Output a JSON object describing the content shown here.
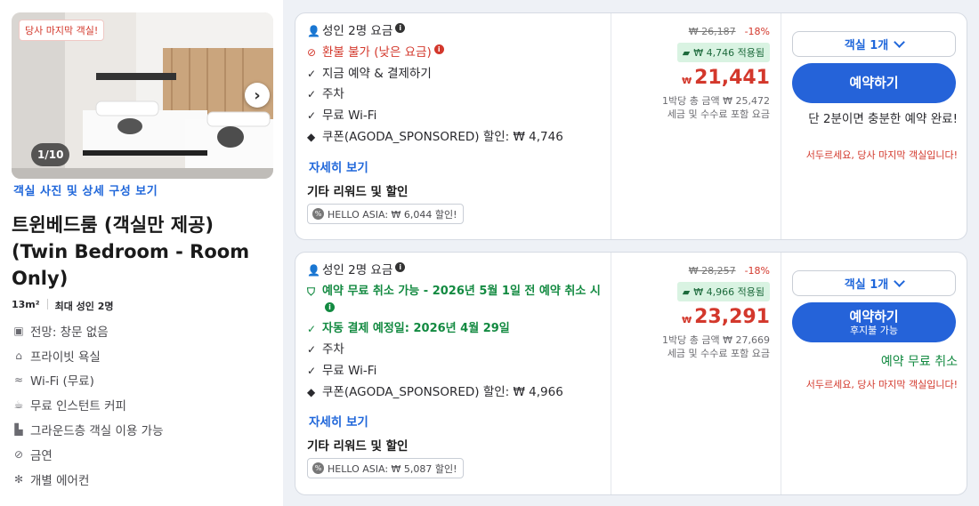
{
  "room": {
    "badge": "당사 마지막 객실!",
    "photo_counter": "1/10",
    "photo_link": "객실 사진 및 상세 구성 보기",
    "title": "트윈베드룸 (객실만 제공) (Twin Bedroom - Room Only)",
    "size": "13m²",
    "occupancy": "최대 성인 2명",
    "features": [
      {
        "icon": "window-icon",
        "label": "전망: 창문 없음"
      },
      {
        "icon": "bathtub-icon",
        "label": "프라이빗 욕실"
      },
      {
        "icon": "wifi-icon",
        "label": "Wi-Fi (무료)"
      },
      {
        "icon": "coffee-icon",
        "label": "무료 인스턴트 커피"
      },
      {
        "icon": "floor-icon",
        "label": "그라운드층 객실 이용 가능"
      },
      {
        "icon": "no-smoking-icon",
        "label": "금연"
      },
      {
        "icon": "aircon-icon",
        "label": "개별 에어컨"
      }
    ]
  },
  "offers": [
    {
      "guests": "성인 2명 요금",
      "cancel": "환불 불가 (낮은 요금)",
      "benefits": [
        "지금 예약 & 결제하기",
        "주차",
        "무료 Wi-Fi"
      ],
      "coupon": "쿠폰(AGODA_SPONSORED) 할인: ₩ 4,746",
      "more": "자세히 보기",
      "other": "기타 리워드 및 할인",
      "promo": "HELLO ASIA: ₩ 6,044 할인!",
      "orig_price": "₩ 26,187",
      "discount": "-18%",
      "applied": "₩ 4,746 적용됨",
      "currency": "₩",
      "price": "21,441",
      "per_night": "1박당 총 금액 ₩ 25,472",
      "tax_note": "세금 및 수수료 포함 요금",
      "room_select": "객실 1개",
      "book_label": "예약하기",
      "note": "단 2분이면 충분한 예약 완료!",
      "warning": "서두르세요, 당사 마지막 객실입니다!"
    },
    {
      "guests": "성인 2명 요금",
      "cancel": "예약 무료 취소 가능 - 2026년 5월 1일 전 예약 취소 시",
      "auto_pay": "자동 결제 예정일: 2026년 4월 29일",
      "benefits": [
        "주차",
        "무료 Wi-Fi"
      ],
      "coupon": "쿠폰(AGODA_SPONSORED) 할인: ₩ 4,966",
      "more": "자세히 보기",
      "other": "기타 리워드 및 할인",
      "promo": "HELLO ASIA: ₩ 5,087 할인!",
      "orig_price": "₩ 28,257",
      "discount": "-18%",
      "applied": "₩ 4,966 적용됨",
      "currency": "₩",
      "price": "23,291",
      "per_night": "1박당 총 금액 ₩ 27,669",
      "tax_note": "세금 및 수수료 포함 요금",
      "room_select": "객실 1개",
      "book_label": "예약하기",
      "book_sub": "후지불 가능",
      "note": "예약 무료 취소",
      "warning": "서두르세요, 당사 마지막 객실입니다!"
    }
  ],
  "colors": {
    "primary": "#2563d9",
    "price_red": "#d3382c",
    "success_green": "#138a41"
  }
}
